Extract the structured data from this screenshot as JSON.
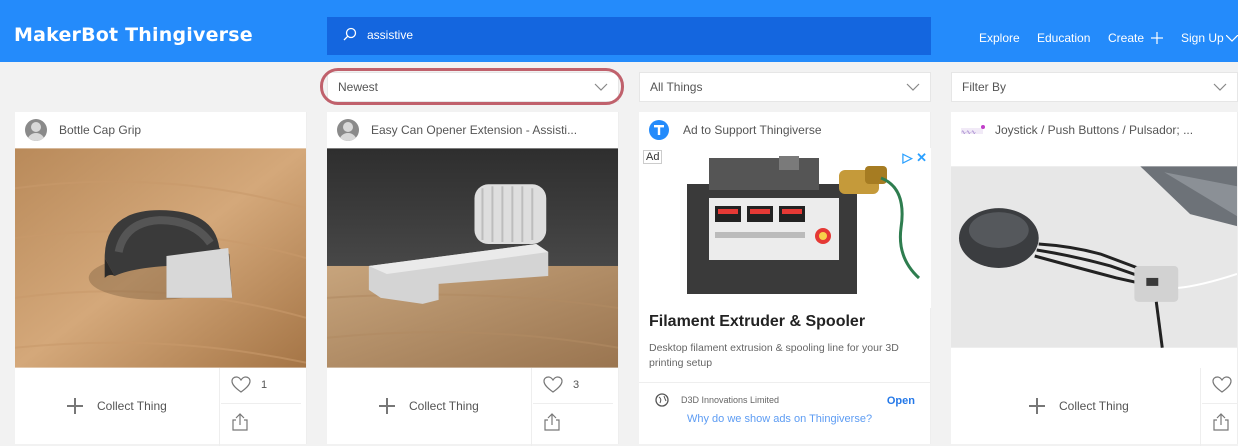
{
  "header": {
    "logo": "MakerBot Thingiverse",
    "search_value": "assistive",
    "nav": [
      "Explore",
      "Education",
      "Create",
      "Sign Up"
    ]
  },
  "filters": {
    "sort": "Newest",
    "type": "All Things",
    "filter": "Filter By"
  },
  "cards": [
    {
      "title": "Bottle Cap Grip",
      "collect_label": "Collect Thing",
      "likes": "1"
    },
    {
      "title": "Easy Can Opener Extension - Assisti...",
      "collect_label": "Collect Thing",
      "likes": "3"
    },
    {
      "title": "Joystick / Push Buttons / Pulsador; ...",
      "collect_label": "Collect Thing",
      "likes": ""
    }
  ],
  "ad": {
    "header": "Ad to Support Thingiverse",
    "badge": "Ad",
    "headline": "Filament Extruder & Spooler",
    "description": "Desktop filament extrusion & spooling line for your 3D printing setup",
    "advertiser": "D3D Innovations Limited",
    "cta": "Open",
    "why": "Why do we show ads on Thingiverse?"
  },
  "colors": {
    "brand": "#248bfb",
    "search_bg": "#1466df",
    "highlight": "#c0616c"
  }
}
